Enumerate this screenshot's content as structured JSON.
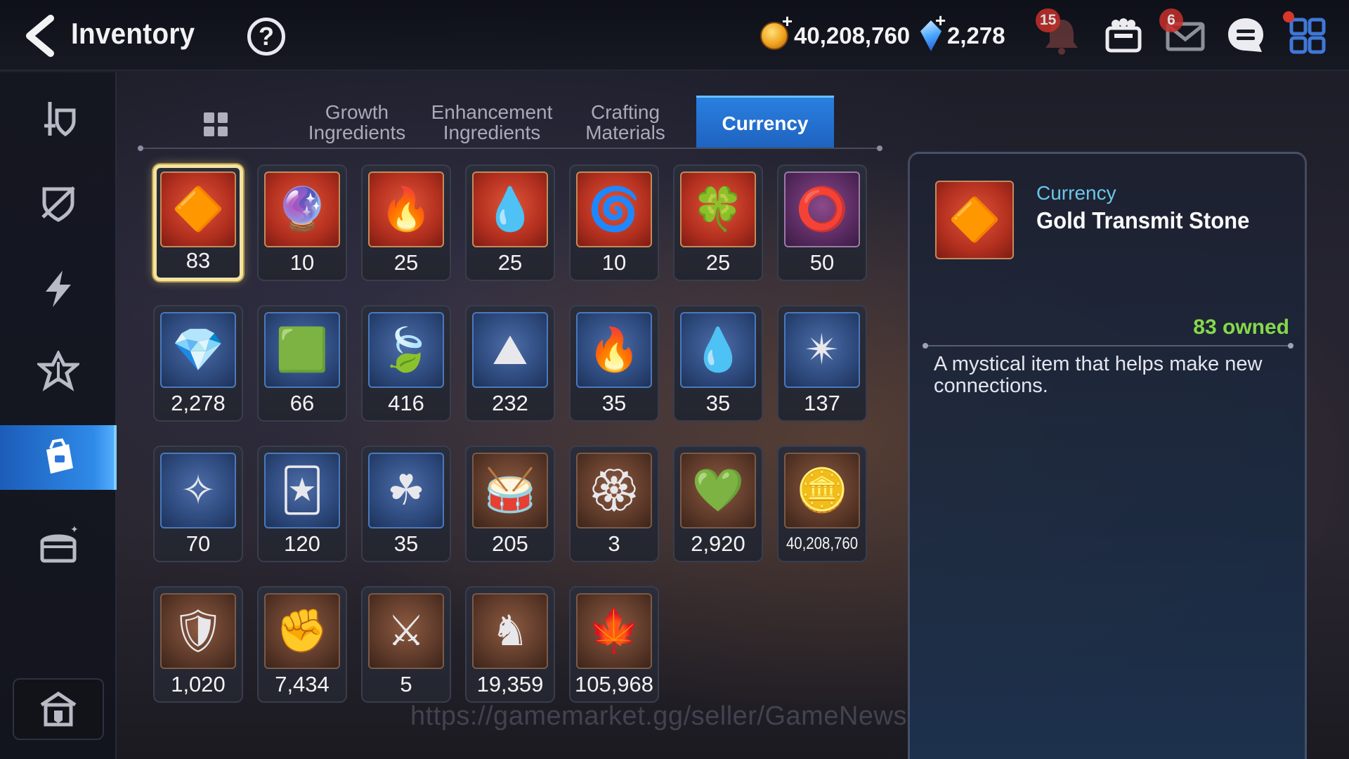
{
  "header": {
    "title": "Inventory",
    "help_label": "?",
    "gold": "40,208,760",
    "crystals": "2,278",
    "notifications_count": "15",
    "mail_count": "6"
  },
  "sidebar": {
    "items": [
      {
        "icon": "sword-shield-icon"
      },
      {
        "icon": "broken-shield-icon"
      },
      {
        "icon": "lightning-icon"
      },
      {
        "icon": "artifact-icon"
      },
      {
        "icon": "bag-icon",
        "active": true
      },
      {
        "icon": "chest-icon"
      }
    ],
    "bottom_icon": "storage-icon"
  },
  "tabs": [
    {
      "label": "Growth\nIngredients"
    },
    {
      "label": "Enhancement\nIngredients"
    },
    {
      "label": "Crafting\nMaterials"
    },
    {
      "label": "Currency",
      "active": true
    }
  ],
  "items": [
    {
      "qty": "83",
      "glyph": "🔶",
      "frame": "red",
      "icon": "gold-transmit-stone-icon"
    },
    {
      "qty": "10",
      "glyph": "🔮",
      "frame": "red",
      "icon": "purple-disc-icon"
    },
    {
      "qty": "25",
      "glyph": "🔥",
      "frame": "red",
      "icon": "flame-charm-icon"
    },
    {
      "qty": "25",
      "glyph": "💧",
      "frame": "red",
      "icon": "water-charm-icon"
    },
    {
      "qty": "10",
      "glyph": "🌀",
      "frame": "red",
      "icon": "dark-charm-icon"
    },
    {
      "qty": "25",
      "glyph": "🍀",
      "frame": "red",
      "icon": "clover-charm-icon"
    },
    {
      "qty": "50",
      "glyph": "⭕",
      "frame": "purple",
      "icon": "ring-charm-icon"
    },
    {
      "qty": "2,278",
      "glyph": "💎",
      "frame": "blue",
      "icon": "crystal-icon"
    },
    {
      "qty": "66",
      "glyph": "🟩",
      "frame": "blue",
      "icon": "green-crystal-icon"
    },
    {
      "qty": "416",
      "glyph": "🍃",
      "frame": "blue",
      "icon": "leaf-icon"
    },
    {
      "qty": "232",
      "glyph": "⛰",
      "frame": "blue",
      "icon": "crystal-mountain-icon"
    },
    {
      "qty": "35",
      "glyph": "🔥",
      "frame": "blue",
      "icon": "flame-charm-icon"
    },
    {
      "qty": "35",
      "glyph": "💧",
      "frame": "blue",
      "icon": "water-charm-icon"
    },
    {
      "qty": "137",
      "glyph": "✴",
      "frame": "blue",
      "icon": "star-charm-icon"
    },
    {
      "qty": "70",
      "glyph": "✧",
      "frame": "blue",
      "icon": "pink-star-charm-icon"
    },
    {
      "qty": "120",
      "glyph": "🃏",
      "frame": "blue",
      "icon": "card-icon"
    },
    {
      "qty": "35",
      "glyph": "☘",
      "frame": "blue",
      "icon": "clover-charm-icon"
    },
    {
      "qty": "205",
      "glyph": "🥁",
      "frame": "brown",
      "icon": "red-drum-icon"
    },
    {
      "qty": "3",
      "glyph": "🏵",
      "frame": "brown",
      "icon": "purple-seal-icon"
    },
    {
      "qty": "2,920",
      "glyph": "💚",
      "frame": "brown",
      "icon": "heart-icon"
    },
    {
      "qty": "40,208,760",
      "glyph": "🪙",
      "frame": "brown",
      "icon": "gold-coin-icon",
      "small": true
    },
    {
      "qty": "1,020",
      "glyph": "🛡",
      "frame": "brown",
      "icon": "gold-emblem-icon"
    },
    {
      "qty": "7,434",
      "glyph": "✊",
      "frame": "brown",
      "icon": "fist-emblem-icon"
    },
    {
      "qty": "5",
      "glyph": "⚔",
      "frame": "brown",
      "icon": "banner-icon"
    },
    {
      "qty": "19,359",
      "glyph": "♞",
      "frame": "brown",
      "icon": "knight-piece-icon"
    },
    {
      "qty": "105,968",
      "glyph": "🍁",
      "frame": "brown",
      "icon": "red-leaf-icon"
    }
  ],
  "detail": {
    "category": "Currency",
    "name": "Gold Transmit Stone",
    "owned": "83 owned",
    "description": "A mystical item that helps make new connections.",
    "glyph": "🔶"
  },
  "watermark": "https://gamemarket.gg/seller/GameNews"
}
